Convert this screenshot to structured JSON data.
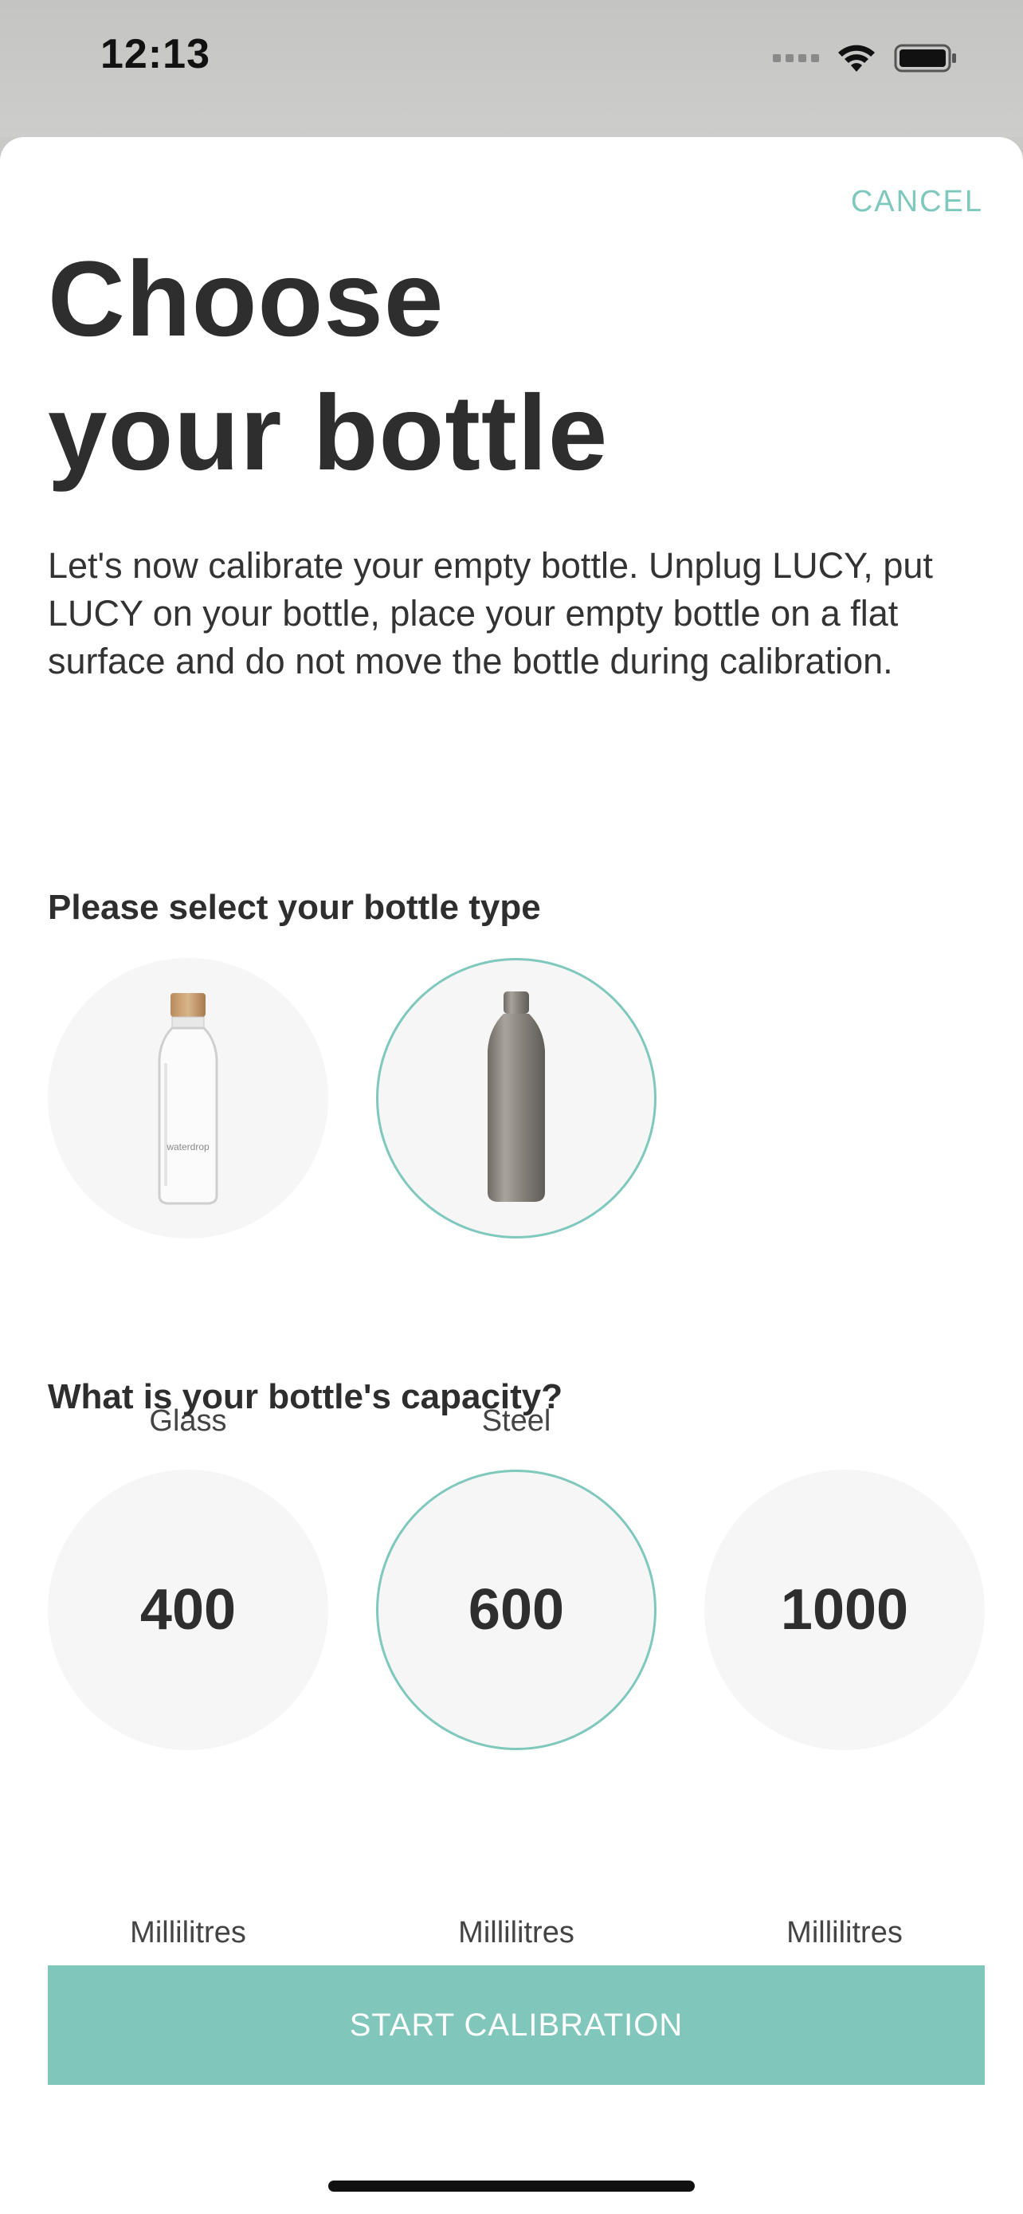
{
  "status": {
    "time": "12:13"
  },
  "header": {
    "cancel_label": "CANCEL"
  },
  "title": {
    "line1": "Choose",
    "line2": "your bottle"
  },
  "description": "Let's now calibrate your empty bottle. Unplug LUCY, put LUCY on your bottle, place your empty bottle on a flat surface and do not move the bottle during calibration.",
  "bottle_type": {
    "label": "Please select your bottle type",
    "options": [
      {
        "label": "Glass",
        "selected": false,
        "brand_text": "waterdrop"
      },
      {
        "label": "Steel",
        "selected": true
      }
    ]
  },
  "capacity": {
    "label": "What is your bottle's capacity?",
    "options": [
      {
        "value": "400",
        "unit": "Millilitres",
        "selected": false
      },
      {
        "value": "600",
        "unit": "Millilitres",
        "selected": true
      },
      {
        "value": "1000",
        "unit": "Millilitres",
        "selected": false
      }
    ]
  },
  "actions": {
    "start_label": "START CALIBRATION"
  },
  "colors": {
    "accent": "#7fc8bd",
    "button": "#81c6bb",
    "option_bg": "#f6f6f6"
  }
}
